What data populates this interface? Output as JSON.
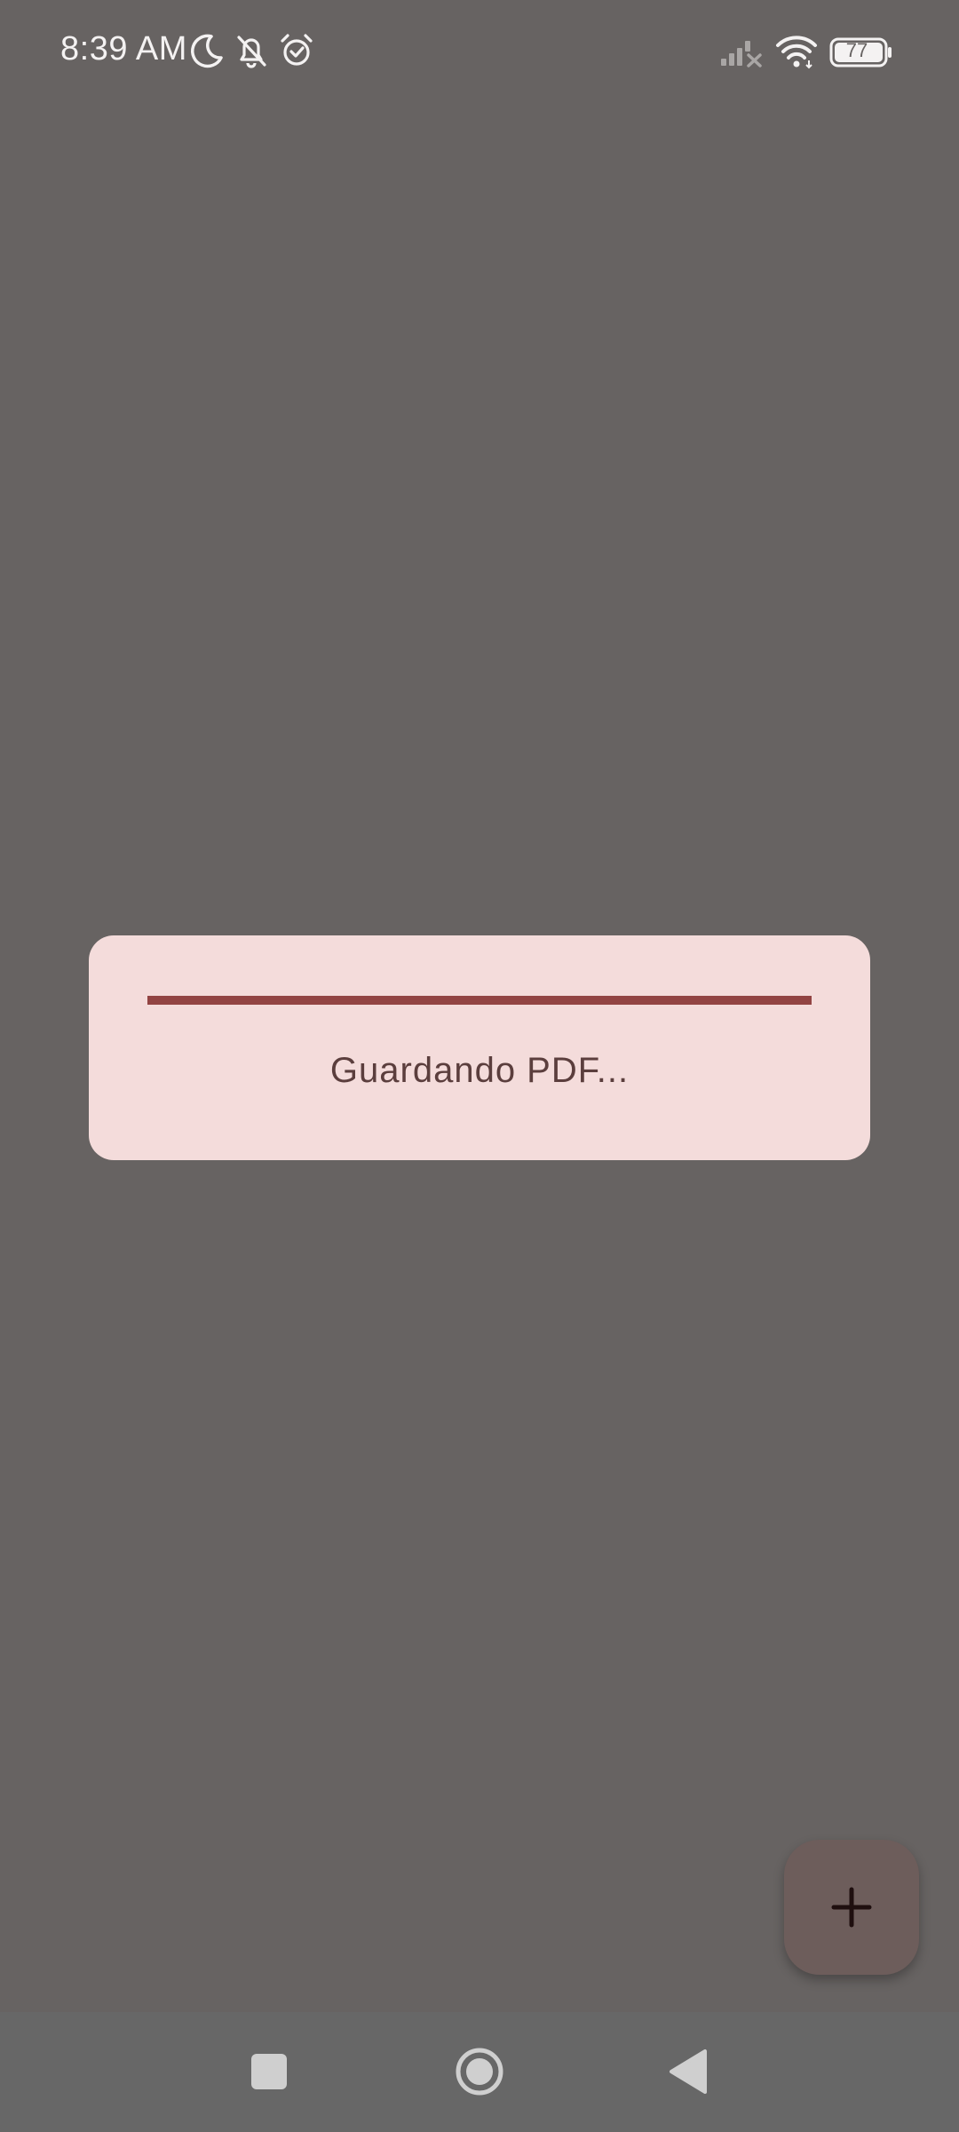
{
  "status_bar": {
    "time": "8:39 AM",
    "icons": [
      "moon-icon",
      "bell-off-icon",
      "alarm-icon",
      "signal-off-icon",
      "wifi-icon",
      "battery-icon"
    ],
    "battery_level": "77"
  },
  "dialog": {
    "message": "Guardando PDF...",
    "progress_fraction": 1.0,
    "colors": {
      "background": "#f4dcdb",
      "progress": "#924443",
      "text": "#5b3e3d"
    }
  },
  "fab": {
    "icon": "plus-icon",
    "color": "#6d5d5b"
  },
  "nav_bar": {
    "buttons": [
      "recents-square-icon",
      "home-circle-icon",
      "back-triangle-icon"
    ]
  },
  "colors": {
    "scrim": "#676362"
  }
}
